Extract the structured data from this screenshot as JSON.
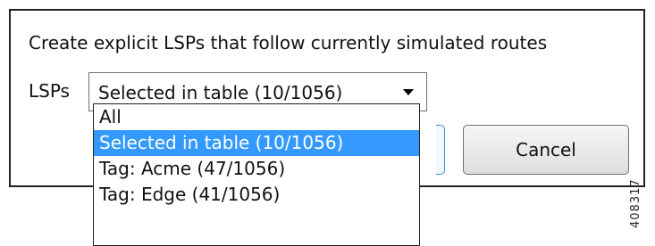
{
  "dialog": {
    "prompt": "Create explicit LSPs that follow currently simulated routes",
    "lsps_label": "LSPs",
    "combo": {
      "value": "Selected in table (10/1056)",
      "arrow_icon": "dropdown-arrow-icon"
    },
    "cancel_label": "Cancel"
  },
  "dropdown": {
    "options": [
      "All",
      "Selected in table (10/1056)",
      "Tag: Acme (47/1056)",
      "Tag: Edge (41/1056)"
    ],
    "selected_index": 1
  },
  "figure_id": "408317",
  "colors": {
    "selection": "#3399ff",
    "focus_border": "#3c8fd6"
  }
}
